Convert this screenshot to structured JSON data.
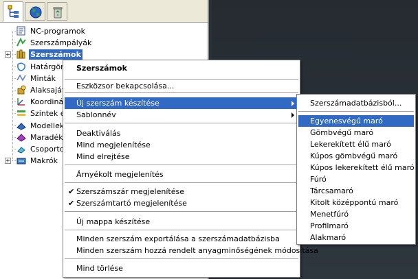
{
  "tabs": [
    {
      "name": "tree-view-icon"
    },
    {
      "name": "globe-icon"
    },
    {
      "name": "recycle-bin-icon"
    }
  ],
  "tree": [
    {
      "label": "NC-programok",
      "icon": "nc-program-icon",
      "expandable": false
    },
    {
      "label": "Szerszámpályák",
      "icon": "toolpath-icon",
      "expandable": false
    },
    {
      "label": "Szerszámok",
      "icon": "tools-icon",
      "expandable": true,
      "selected": true
    },
    {
      "label": "Határgörb",
      "icon": "boundary-icon",
      "expandable": false
    },
    {
      "label": "Minták",
      "icon": "pattern-icon",
      "expandable": false
    },
    {
      "label": "Alaksajátó",
      "icon": "feature-icon",
      "expandable": false
    },
    {
      "label": "Koordináta",
      "icon": "workplane-icon",
      "expandable": false
    },
    {
      "label": "Szintek és",
      "icon": "levels-icon",
      "expandable": false
    },
    {
      "label": "Modellek",
      "icon": "models-icon",
      "expandable": false
    },
    {
      "label": "Maradékm",
      "icon": "stock-model-icon",
      "expandable": false
    },
    {
      "label": "Csoportok",
      "icon": "groups-icon",
      "expandable": false
    },
    {
      "label": "Makrók",
      "icon": "macros-icon",
      "expandable": true
    }
  ],
  "context_menu": {
    "items": [
      {
        "label": "Szerszámok",
        "bold": true
      },
      {
        "separator": true
      },
      {
        "label": "Eszközsor bekapcsolása..."
      },
      {
        "separator": true
      },
      {
        "label": "Új szerszám készítése",
        "submenu": true,
        "highlight": true
      },
      {
        "label": "Sablonnév",
        "submenu": true
      },
      {
        "separator": true
      },
      {
        "label": "Deaktiválás"
      },
      {
        "label": "Mind megjelenítése"
      },
      {
        "label": "Mind elrejtése"
      },
      {
        "separator": true
      },
      {
        "label": "Árnyékolt megjelenítés"
      },
      {
        "separator": true
      },
      {
        "label": "Szerszámszár megjelenítése",
        "checked": true
      },
      {
        "label": "Szerszámtartó megjelenítése",
        "checked": true
      },
      {
        "separator": true
      },
      {
        "label": "Új mappa készítése"
      },
      {
        "separator": true
      },
      {
        "label": "Minden szerszám exportálása a szerszámadatbázisba"
      },
      {
        "label": "Minden szerszám hozzá rendelt anyagminőségének módosítása"
      },
      {
        "separator": true
      },
      {
        "label": "Mind törlése"
      }
    ]
  },
  "submenu": {
    "items": [
      {
        "label": "Szerszámadatbázisból..."
      },
      {
        "separator": true
      },
      {
        "label": "Egyenesvégű maró",
        "highlight": true
      },
      {
        "label": "Gömbvégű maró"
      },
      {
        "label": "Lekerekített élű maró"
      },
      {
        "label": "Kúpos gömbvégű maró"
      },
      {
        "label": "Kúpos lekerekített élű maró"
      },
      {
        "label": "Fúró"
      },
      {
        "label": "Tárcsamaró"
      },
      {
        "label": "Kitolt középpontú maró"
      },
      {
        "label": "Menetfúró"
      },
      {
        "label": "Profilmaró"
      },
      {
        "label": "Alakmaró"
      }
    ]
  },
  "colors": {
    "highlight": "#316ac5",
    "viewport": "#2a3138"
  }
}
